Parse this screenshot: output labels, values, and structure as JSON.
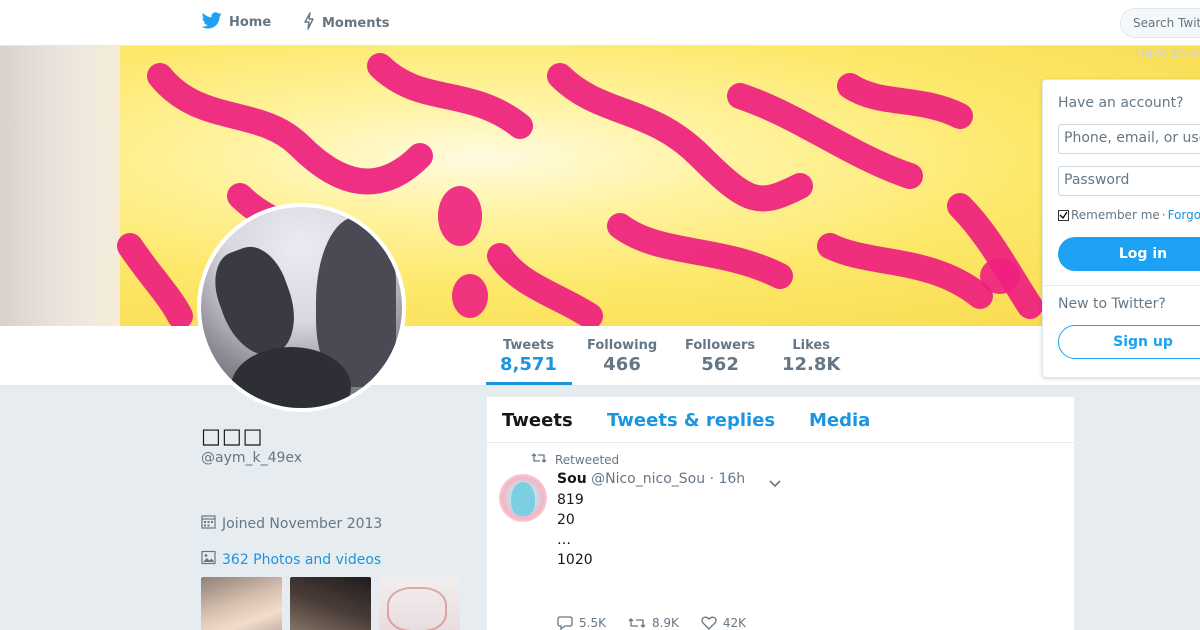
{
  "nav": {
    "home_label": "Home",
    "moments_label": "Moments",
    "search_placeholder": "Search Twitter",
    "have_account_faint": "Have an account?"
  },
  "colors": {
    "accent": "#1b95e0",
    "button_blue": "#1da1f2",
    "muted": "#657786",
    "banner_yellow": "#fde86a",
    "banner_pink": "#f0288a"
  },
  "profile": {
    "name": "□□□",
    "handle": "@aym_k_49ex",
    "joined": "Joined November 2013",
    "photos_link": "362 Photos and videos"
  },
  "stats": [
    {
      "label": "Tweets",
      "value": "8,571"
    },
    {
      "label": "Following",
      "value": "466"
    },
    {
      "label": "Followers",
      "value": "562"
    },
    {
      "label": "Likes",
      "value": "12.8K"
    }
  ],
  "timeline": {
    "tabs": [
      "Tweets",
      "Tweets & replies",
      "Media"
    ],
    "tweet": {
      "retweeted_label": "Retweeted",
      "author": "Sou",
      "handle": "@Nico_nico_Sou",
      "time": "· 16h",
      "lines": [
        "819",
        "20",
        "…",
        "1020"
      ],
      "replies": "5.5K",
      "retweets": "8.9K",
      "likes": "42K"
    }
  },
  "login": {
    "title": "Have an account?",
    "phone_placeholder": "Phone, email, or username",
    "password_placeholder": "Password",
    "remember_label": "Remember me",
    "separator": "·",
    "forgot_label": "Forgot password?",
    "login_button": "Log in",
    "new_to_twitter": "New to Twitter?",
    "signup_button": "Sign up"
  }
}
